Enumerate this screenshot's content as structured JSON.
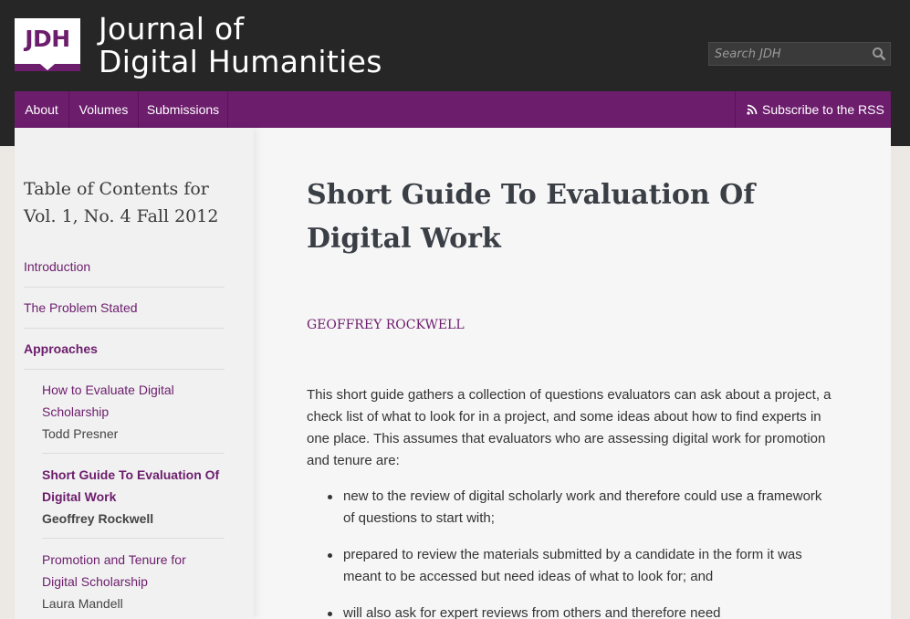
{
  "header": {
    "logo_text": "JDH",
    "site_title_line1": "Journal of",
    "site_title_line2": "Digital Humanities",
    "search_placeholder": "Search JDH"
  },
  "nav": {
    "items": [
      {
        "label": "About"
      },
      {
        "label": "Volumes"
      },
      {
        "label": "Submissions"
      }
    ],
    "rss_label": "Subscribe to the RSS"
  },
  "sidebar": {
    "toc_title": "Table of Contents for Vol. 1, No. 4 Fall 2012",
    "sections": [
      {
        "label": "Introduction"
      },
      {
        "label": "The Problem Stated"
      },
      {
        "label": "Approaches"
      }
    ],
    "articles": [
      {
        "title": "How to Evaluate Digital Scholarship",
        "author": "Todd Presner"
      },
      {
        "title": "Short Guide To Evaluation Of Digital Work",
        "author": "Geoffrey Rockwell"
      },
      {
        "title": "Promotion and Tenure for Digital Scholarship",
        "author": "Laura Mandell"
      }
    ]
  },
  "article": {
    "title": "Short Guide To Evaluation Of Digital Work",
    "author": "GEOFFREY ROCKWELL",
    "intro": "This short guide gathers a collection of questions evaluators can ask about a project, a check list of what to look for in a project, and some ideas about how to find experts in one place. This assumes that evaluators who are assessing digital work for promotion and tenure are:",
    "bullets": [
      "new to the review of digital scholarly work and therefore could use a framework of questions to start with;",
      "prepared to review the materials submitted by a candidate in the form it was meant to be accessed but need ideas of what to look for; and",
      "will also ask for expert reviews from others and therefore need"
    ]
  },
  "colors": {
    "brand_purple": "#6c1d6c",
    "header_dark": "#262626"
  }
}
